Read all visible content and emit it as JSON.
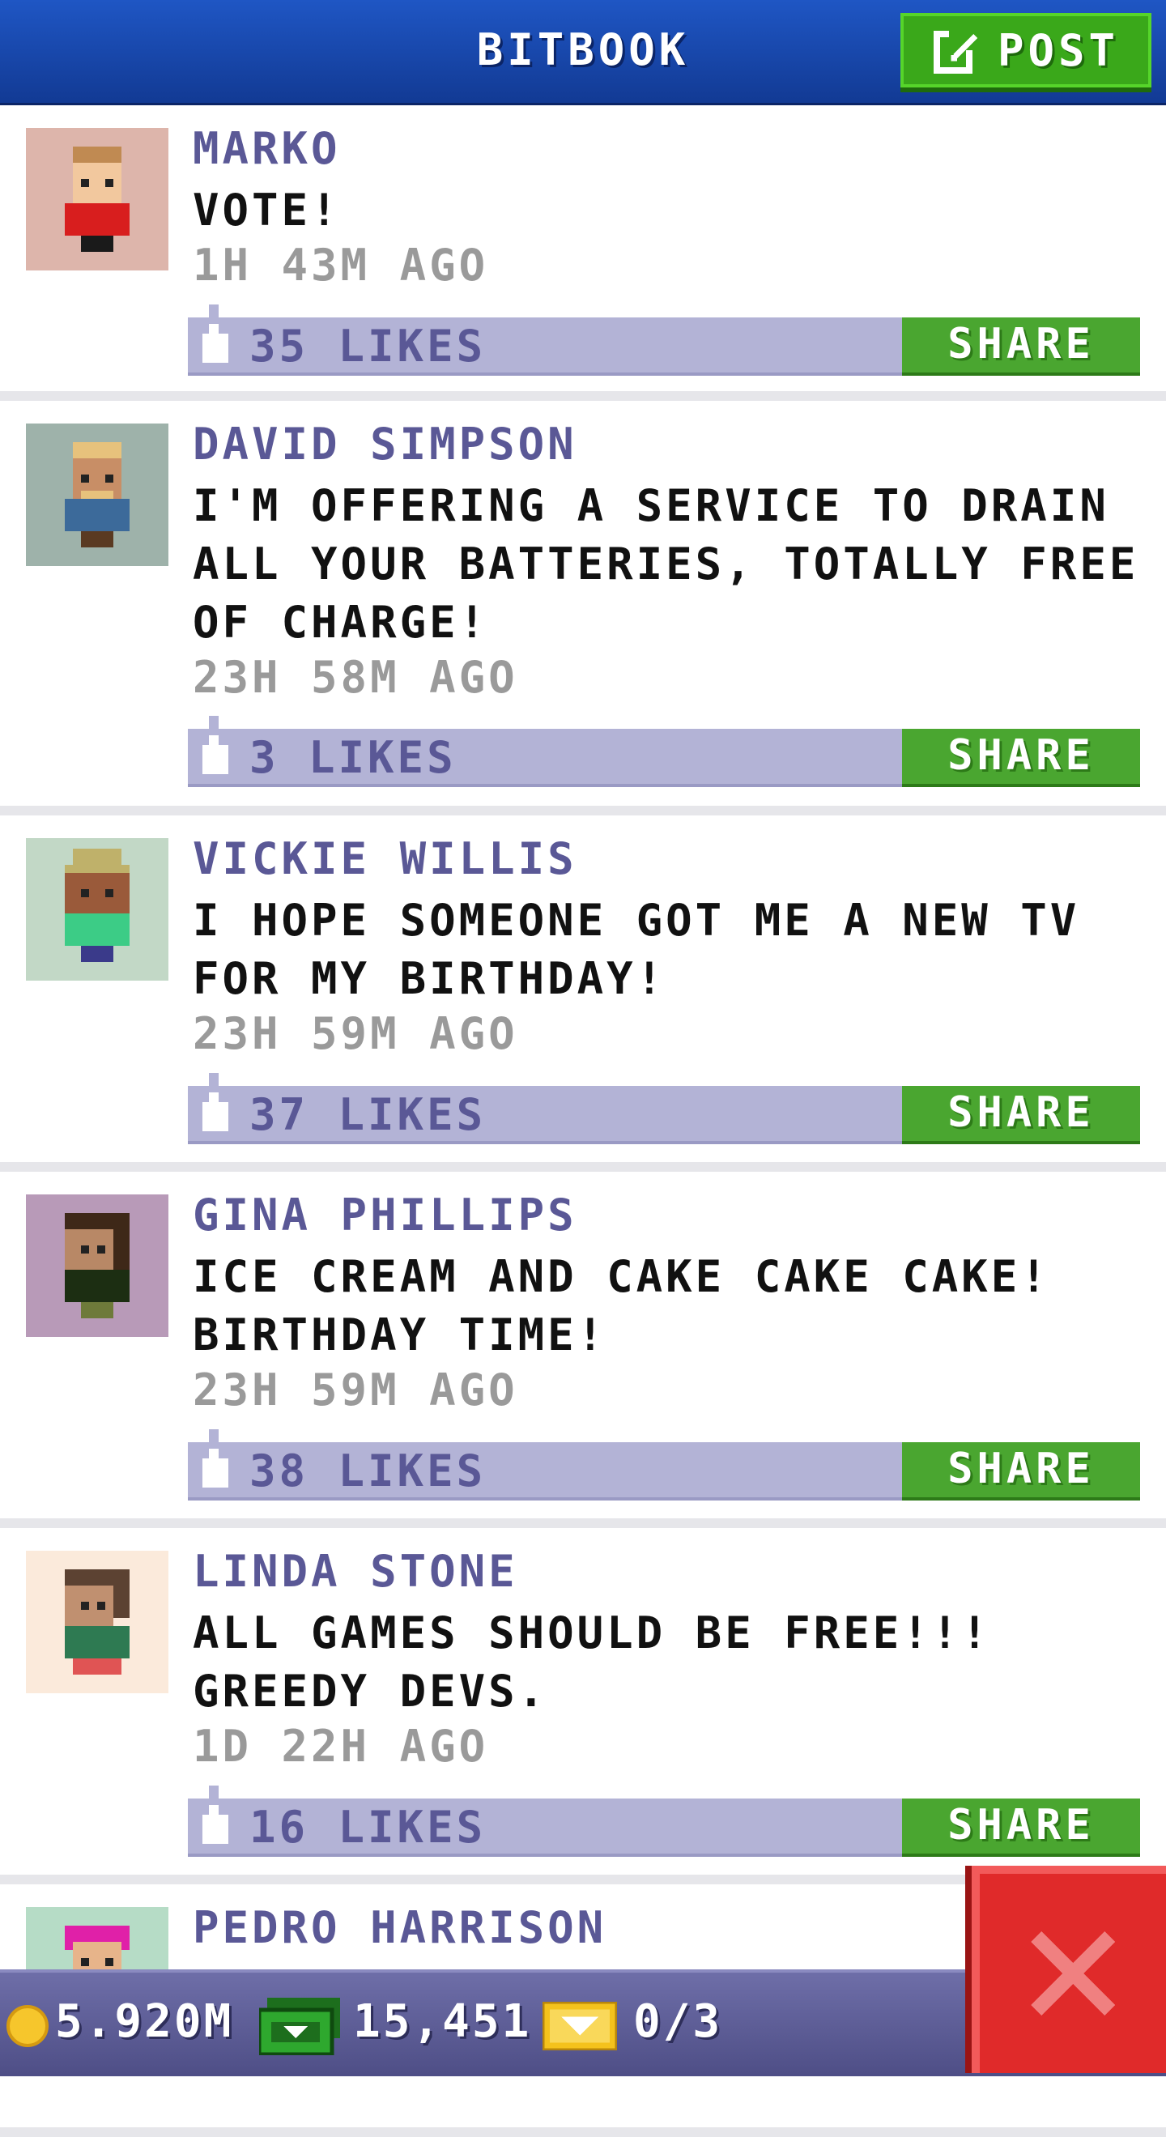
{
  "app": {
    "title": "BITBOOK",
    "post_label": "POST",
    "share_label": "SHARE"
  },
  "posts": [
    {
      "name": "MARKO",
      "message": "VOTE!",
      "time": "1H 43M AGO",
      "likes": "35 LIKES",
      "avatar_bg": "#ddb5ab",
      "skin": "#f2c89e",
      "hair": "#c08a52",
      "shirt": "#d81e1e",
      "pants": "#1a1a1a"
    },
    {
      "name": "DAVID SIMPSON",
      "message": "I'M OFFERING A SERVICE TO DRAIN ALL YOUR BATTERIES, TOTALLY FREE OF CHARGE!",
      "time": "23H 58M AGO",
      "likes": "3 LIKES",
      "avatar_bg": "#9eb2aa",
      "skin": "#c88e66",
      "hair": "#e7c27c",
      "shirt": "#3c6a9a",
      "pants": "#5a3a22"
    },
    {
      "name": "VICKIE WILLIS",
      "message": "I HOPE SOMEONE GOT ME A NEW TV FOR MY BIRTHDAY!",
      "time": "23H 59M AGO",
      "likes": "37 LIKES",
      "avatar_bg": "#c2d8c6",
      "skin": "#9a5a3a",
      "hair": "#bfb16a",
      "shirt": "#3ccc86",
      "pants": "#3a3a8a"
    },
    {
      "name": "GINA PHILLIPS",
      "message": "ICE CREAM AND CAKE CAKE CAKE! BIRTHDAY TIME!",
      "time": "23H 59M AGO",
      "likes": "38 LIKES",
      "avatar_bg": "#b89ab8",
      "skin": "#b88866",
      "hair": "#3e2818",
      "shirt": "#1c2e12",
      "pants": "#6e7a3a"
    },
    {
      "name": "LINDA STONE",
      "message": "ALL GAMES SHOULD BE FREE!!! GREEDY DEVS.",
      "time": "1D 22H AGO",
      "likes": "16 LIKES",
      "avatar_bg": "#fbeadb",
      "skin": "#c09070",
      "hair": "#5c4232",
      "shirt": "#2e7a52",
      "pants": "#e05454"
    },
    {
      "name": "PEDRO HARRISON",
      "message": "",
      "time": "",
      "likes": "",
      "avatar_bg": "#b6dcc6",
      "skin": "#e7b48a",
      "hair": "#e020a8",
      "shirt": "#3a6aa0",
      "pants": "#333333"
    }
  ],
  "resources": {
    "coins": "5.920M",
    "bux": "15,451",
    "tickets": "0/3"
  },
  "icons": {
    "post": "edit-icon",
    "like": "thumbs-up-icon",
    "coin": "coin-icon",
    "bux": "cash-icon",
    "ticket": "ticket-icon",
    "close": "close-icon"
  }
}
